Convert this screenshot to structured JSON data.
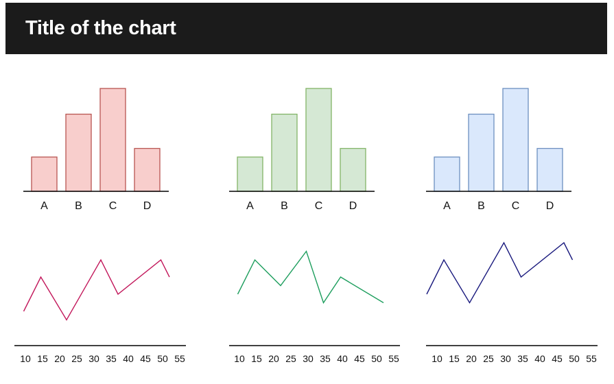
{
  "header": {
    "title": "Title of the chart"
  },
  "chart_data": [
    {
      "type": "bar",
      "title": "",
      "xlabel": "",
      "ylabel": "",
      "categories": [
        "A",
        "B",
        "C",
        "D"
      ],
      "values": [
        4,
        9,
        12,
        5
      ],
      "ylim": [
        0,
        12
      ],
      "colors": {
        "fill": "#f8cecc",
        "stroke": "#b85450"
      }
    },
    {
      "type": "bar",
      "title": "",
      "xlabel": "",
      "ylabel": "",
      "categories": [
        "A",
        "B",
        "C",
        "D"
      ],
      "values": [
        4,
        9,
        12,
        5
      ],
      "ylim": [
        0,
        12
      ],
      "colors": {
        "fill": "#d5e8d4",
        "stroke": "#82b366"
      }
    },
    {
      "type": "bar",
      "title": "",
      "xlabel": "",
      "ylabel": "",
      "categories": [
        "A",
        "B",
        "C",
        "D"
      ],
      "values": [
        4,
        9,
        12,
        5
      ],
      "ylim": [
        0,
        12
      ],
      "colors": {
        "fill": "#dae8fc",
        "stroke": "#6c8ebf"
      }
    },
    {
      "type": "line",
      "title": "",
      "xlabel": "",
      "ylabel": "",
      "x_ticks": [
        "10",
        "15",
        "20",
        "25",
        "30",
        "35",
        "40",
        "45",
        "50",
        "55"
      ],
      "xlim": [
        10,
        55
      ],
      "ylim": [
        0,
        6
      ],
      "color": "#c2185b",
      "x": [
        9.5,
        14.5,
        22,
        32,
        37,
        49.5,
        52
      ],
      "y": [
        2,
        4,
        1.5,
        5,
        3,
        5,
        4
      ]
    },
    {
      "type": "line",
      "title": "",
      "xlabel": "",
      "ylabel": "",
      "x_ticks": [
        "10",
        "15",
        "20",
        "25",
        "30",
        "35",
        "40",
        "45",
        "50",
        "55"
      ],
      "xlim": [
        10,
        55
      ],
      "ylim": [
        0,
        6
      ],
      "color": "#1e9e5e",
      "x": [
        9.5,
        14.5,
        22,
        29.5,
        34.5,
        39.5,
        52
      ],
      "y": [
        3,
        5,
        3.5,
        5.5,
        2.5,
        4,
        2.5
      ]
    },
    {
      "type": "line",
      "title": "",
      "xlabel": "",
      "ylabel": "",
      "x_ticks": [
        "10",
        "15",
        "20",
        "25",
        "30",
        "35",
        "40",
        "45",
        "50",
        "55"
      ],
      "xlim": [
        10,
        55
      ],
      "ylim": [
        0,
        6
      ],
      "color": "#1a1a7e",
      "x": [
        7,
        12,
        19.5,
        29.5,
        34.5,
        47,
        49.5
      ],
      "y": [
        3,
        5,
        2.5,
        6,
        4,
        6,
        5
      ]
    }
  ]
}
